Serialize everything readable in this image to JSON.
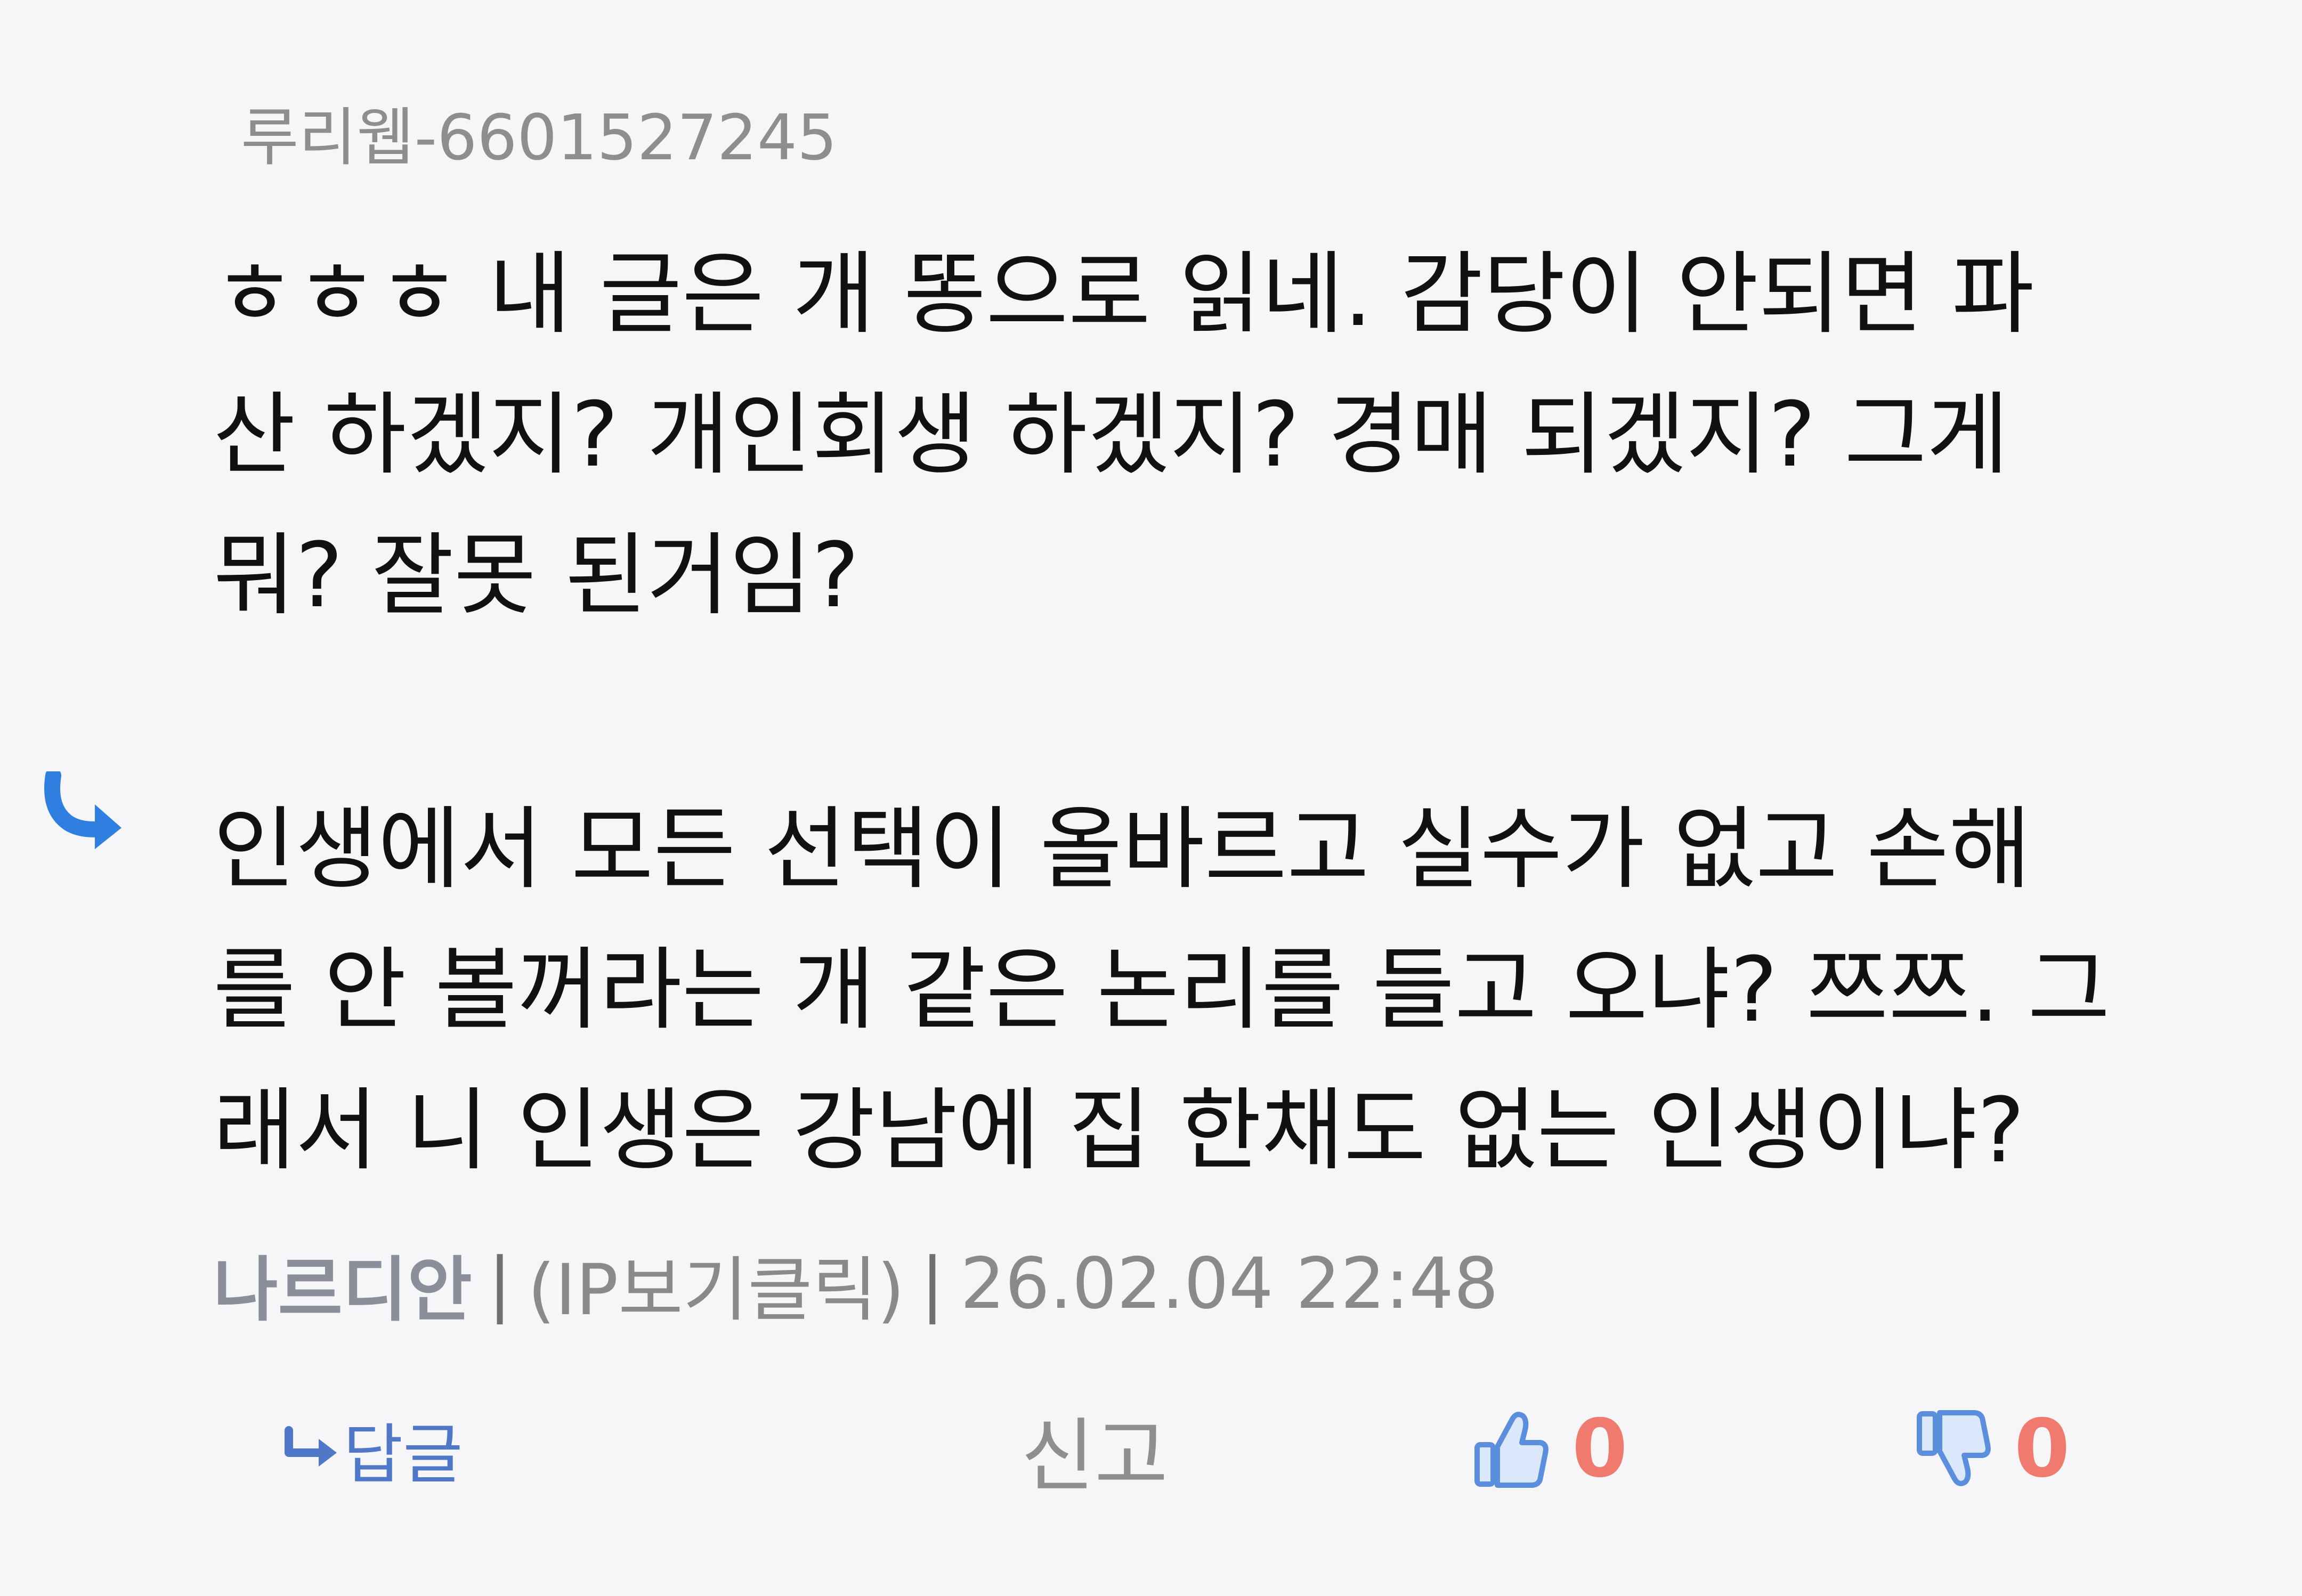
{
  "quoted_comment": {
    "username": "루리웹-6601527245",
    "lines": [
      "ㅎㅎㅎ 내 글은 개 똥으로 읽네. 감당이 안되면 파",
      "산 하겠지? 개인회생 하겠지? 경매 되겠지? 그게",
      "뭐? 잘못 된거임?"
    ]
  },
  "reply_comment": {
    "lines": [
      "인생에서 모든 선택이 올바르고 실수가 없고 손해",
      "를 안 볼꺼라는 개 같은 논리를 들고 오냐? 쯔쯔. 그",
      "래서 니 인생은 강남에 집 한채도 없는 인생이냐?"
    ],
    "author": "나르디안",
    "separator": "|",
    "ip_link": "(IP보기클릭)",
    "datetime": "26.02.04 22:48"
  },
  "actions": {
    "reply_label": "답글",
    "report_label": "신고",
    "like_count": "0",
    "dislike_count": "0"
  },
  "colors": {
    "background": "#f6f6f8",
    "accent_blue": "#2f7fe0",
    "count_red": "#f07a6e",
    "reply_blue": "#4f78c8"
  },
  "icons": {
    "reply_marker": "reply-arrow-icon",
    "reply_button": "reply-arrow-small-icon",
    "like": "thumbs-up-icon",
    "dislike": "thumbs-down-icon"
  }
}
